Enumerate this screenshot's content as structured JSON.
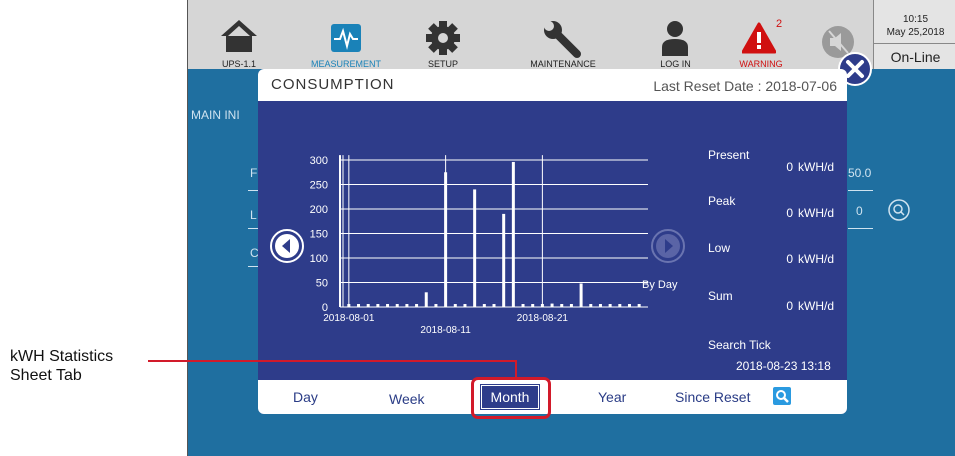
{
  "topbar": {
    "items": [
      {
        "label": "UPS-1.1",
        "icon": "home-icon"
      },
      {
        "label": "MEASUREMENT",
        "icon": "waveform-icon"
      },
      {
        "label": "SETUP",
        "icon": "gear-icon"
      },
      {
        "label": "MAINTENANCE",
        "icon": "wrench-icon"
      },
      {
        "label": "LOG IN",
        "icon": "user-icon"
      },
      {
        "label": "WARNING",
        "icon": "warning-icon",
        "badge": "2"
      },
      {
        "label": "",
        "icon": "mute-icon"
      }
    ],
    "time": "10:15",
    "date": "May 25,2018",
    "status": "On-Line"
  },
  "background": {
    "section_label": "MAIN INI",
    "value_fragment_1": "50.0",
    "value_fragment_2": "0",
    "left_fragment_1": "F",
    "left_fragment_2": "L",
    "left_fragment_3": "C"
  },
  "modal": {
    "title": "CONSUMPTION",
    "last_reset": "Last Reset Date : 2018-07-06",
    "next_label": "By Day",
    "stats": {
      "present_label": "Present",
      "present_value": "0",
      "present_unit": "kWH/d",
      "peak_label": "Peak",
      "peak_value": "0",
      "peak_unit": "kWH/d",
      "low_label": "Low",
      "low_value": "0",
      "low_unit": "kWH/d",
      "sum_label": "Sum",
      "sum_value": "0",
      "sum_unit": "kWH/d"
    },
    "search_tick_label": "Search Tick",
    "search_tick_value": "2018-08-23 13:18",
    "tabs": {
      "day": "Day",
      "week": "Week",
      "month": "Month",
      "year": "Year",
      "since_reset": "Since Reset"
    }
  },
  "callout": {
    "line1": "kWH Statistics",
    "line2": "Sheet Tab"
  },
  "colors": {
    "panel_bg": "#2e3c8a",
    "device_bg": "#1f6fa0",
    "callout_red": "#d21a2a",
    "warning_red": "#d01010",
    "active_blue": "#1a82b8"
  },
  "chart_data": {
    "type": "bar",
    "x_tick_labels": [
      "2018-08-01",
      "2018-08-11",
      "2018-08-21"
    ],
    "y_ticks": [
      0,
      50,
      100,
      150,
      200,
      250,
      300
    ],
    "ylim": [
      0,
      310
    ],
    "grid": true,
    "days": [
      1,
      2,
      3,
      4,
      5,
      6,
      7,
      8,
      9,
      10,
      11,
      12,
      13,
      14,
      15,
      16,
      17,
      18,
      19,
      20,
      21,
      22,
      23,
      24,
      25,
      26,
      27,
      28,
      29,
      30,
      31
    ],
    "values": [
      0,
      0,
      0,
      0,
      0,
      0,
      0,
      0,
      30,
      0,
      275,
      0,
      0,
      240,
      0,
      0,
      190,
      296,
      0,
      0,
      0,
      7,
      0,
      0,
      48,
      0,
      0,
      0,
      0,
      0,
      0
    ]
  }
}
